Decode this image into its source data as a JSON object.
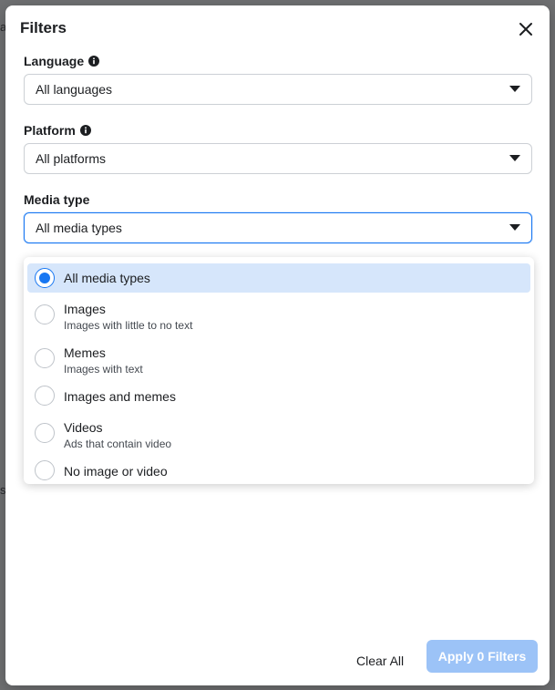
{
  "background": {
    "left_fragment": "a",
    "left_mid_fragment": "s"
  },
  "modal": {
    "title": "Filters",
    "close_icon": "close-icon"
  },
  "filters": {
    "language": {
      "label": "Language",
      "value": "All languages"
    },
    "platform": {
      "label": "Platform",
      "value": "All platforms"
    },
    "media_type": {
      "label": "Media type",
      "value": "All media types"
    }
  },
  "media_options": [
    {
      "label": "All media types",
      "sub": "",
      "selected": true
    },
    {
      "label": "Images",
      "sub": "Images with little to no text",
      "selected": false
    },
    {
      "label": "Memes",
      "sub": "Images with text",
      "selected": false
    },
    {
      "label": "Images and memes",
      "sub": "",
      "selected": false
    },
    {
      "label": "Videos",
      "sub": "Ads that contain video",
      "selected": false
    },
    {
      "label": "No image or video",
      "sub": "",
      "selected": false
    }
  ],
  "footer": {
    "clear_label": "Clear All",
    "apply_label": "Apply 0 Filters"
  },
  "colors": {
    "accent": "#1877f2",
    "selected_bg": "#d6e6fb",
    "apply_disabled": "#9cc3f7"
  }
}
